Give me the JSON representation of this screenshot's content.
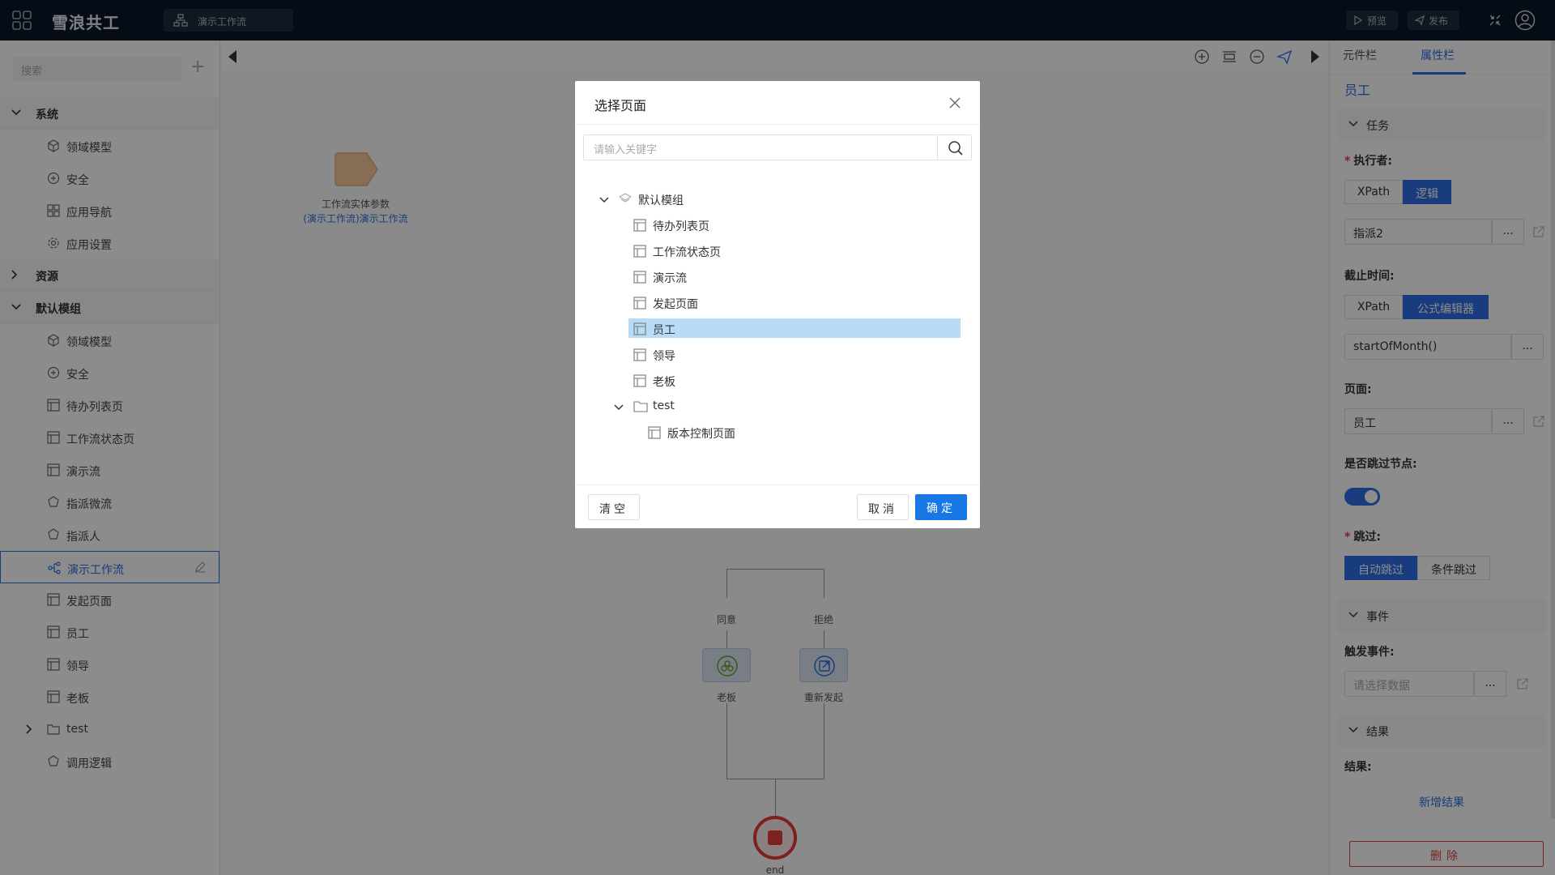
{
  "app": {
    "logo": "雪浪共工",
    "workflow_tab": "演示工作流",
    "preview": "预览",
    "publish": "发布"
  },
  "sidebar": {
    "search_placeholder": "搜索",
    "plus": "+",
    "groups": {
      "system": {
        "label": "系统",
        "items": [
          "领域模型",
          "安全",
          "应用导航",
          "应用设置"
        ]
      },
      "resources": {
        "label": "资源"
      },
      "default": {
        "label": "默认模组",
        "items": [
          "领域模型",
          "安全",
          "待办列表页",
          "工作流状态页",
          "演示流",
          "指派微流",
          "指派人",
          "演示工作流",
          "发起页面",
          "员工",
          "领导",
          "老板",
          "test",
          "调用逻辑"
        ]
      }
    }
  },
  "canvas": {
    "param_node": "工作流实体参数",
    "param_link": "(演示工作流)演示工作流",
    "branch_agree": "同意",
    "branch_reject": "拒绝",
    "node_boss": "老板",
    "node_restart": "重新发起",
    "end": "end"
  },
  "rpanel": {
    "tab_components": "元件栏",
    "tab_properties": "属性栏",
    "title": "员工",
    "sec_task": "任务",
    "executor_label": "执行者:",
    "seg_xpath": "XPath",
    "seg_logic": "逻辑",
    "executor_value": "指派2",
    "dots": "...",
    "deadline_label": "截止时间:",
    "seg_formula": "公式编辑器",
    "deadline_value": "startOfMonth()",
    "page_label": "页面:",
    "page_value": "员工",
    "skip_node_label": "是否跳过节点:",
    "skip_label": "跳过:",
    "seg_auto_skip": "自动跳过",
    "seg_cond_skip": "条件跳过",
    "sec_event": "事件",
    "trigger_label": "触发事件:",
    "trigger_placeholder": "请选择数据",
    "sec_result": "结果",
    "result_label": "结果:",
    "add_result": "新增结果",
    "delete": "删除"
  },
  "modal": {
    "title": "选择页面",
    "search_placeholder": "请输入关键字",
    "tree": {
      "root": "默认模组",
      "pages": [
        "待办列表页",
        "工作流状态页",
        "演示流",
        "发起页面",
        "员工",
        "领导",
        "老板"
      ],
      "folder": "test",
      "folder_pages": [
        "版本控制页面"
      ]
    },
    "selected": "员工",
    "clear": "清空",
    "cancel": "取消",
    "ok": "确定"
  },
  "colors": {
    "accent": "#2d6de3",
    "topbar": "#0b1628",
    "danger": "#e23b3b",
    "selection": "#b8dcf5"
  }
}
